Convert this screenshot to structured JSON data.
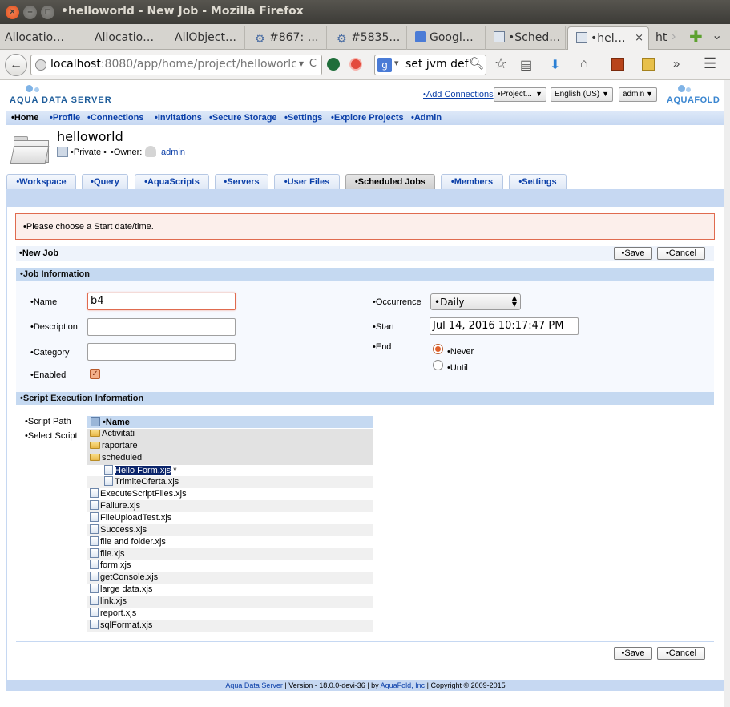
{
  "window": {
    "title": "•helloworld - New Job - Mozilla Firefox",
    "close": "×",
    "minimize": "–",
    "maximize": "□"
  },
  "tabs": [
    {
      "label": "Allocatio…",
      "icon": "ellipsis-icon"
    },
    {
      "label": "Allocatio…"
    },
    {
      "label": "AllObject…"
    },
    {
      "label": "#867: …",
      "icon": "gear-icon"
    },
    {
      "label": "#5835…",
      "icon": "gear-icon"
    },
    {
      "label": "Googl…",
      "icon": "google-translate-icon"
    },
    {
      "label": "•Sched…",
      "icon": "page-icon"
    },
    {
      "label": "•hel…",
      "icon": "page-icon",
      "active": true,
      "close": "×"
    },
    {
      "label": "ht"
    }
  ],
  "tabstrip": {
    "scroll_right": "›",
    "new_tab": "✚",
    "list_tabs": "⌄"
  },
  "nav": {
    "url_host": "localhost",
    "url_rest": ":8080/app/home/project/helloworlc",
    "search_text": "set jvm defa",
    "back": "←",
    "dropdown": "▾",
    "reload": "C",
    "search_engine": "g"
  },
  "app": {
    "logo_left": "AQUA DATA SERVER",
    "logo_right": "AQUAFOLD",
    "add_connections": "•Add Connections",
    "project_select": "•Project...",
    "language_select": "English (US)",
    "user_select": "admin"
  },
  "menu": [
    {
      "label": "•Home",
      "current": true
    },
    {
      "label": "•Profile"
    },
    {
      "label": "•Connections"
    },
    {
      "label": "•Invitations"
    },
    {
      "label": "•Secure Storage"
    },
    {
      "label": "•Settings"
    },
    {
      "label": "•Explore Projects"
    },
    {
      "label": "•Admin"
    }
  ],
  "project": {
    "name": "helloworld",
    "privacy": "•Private •",
    "owner_label": "•Owner:",
    "owner": "admin"
  },
  "project_tabs": [
    {
      "label": "•Workspace"
    },
    {
      "label": "•Query"
    },
    {
      "label": "•AquaScripts"
    },
    {
      "label": "•Servers"
    },
    {
      "label": "•User Files"
    },
    {
      "label": "•Scheduled Jobs",
      "active": true
    },
    {
      "label": "•Members"
    },
    {
      "label": "•Settings"
    }
  ],
  "error_message": "•Please choose a Start date/time.",
  "form": {
    "title": "•New Job",
    "save": "•Save",
    "cancel": "•Cancel",
    "job_info_header": "•Job Information",
    "name_label": "•Name",
    "name_value": "b4",
    "description_label": "•Description",
    "description_value": "",
    "category_label": "•Category",
    "category_value": "",
    "enabled_label": "•Enabled",
    "enabled": true,
    "occurrence_label": "•Occurrence",
    "occurrence_value": "•Daily",
    "start_label": "•Start",
    "start_value": "Jul 14, 2016 10:17:47 PM",
    "end_label": "•End",
    "end_never": "•Never",
    "end_until": "•Until",
    "end_selected": "never",
    "script_header": "•Script Execution Information",
    "script_path_label": "•Script Path",
    "select_script_label": "•Select Script"
  },
  "tree": {
    "header": "•Name",
    "rows": [
      {
        "label": "Activitati",
        "type": "folder",
        "level": 0
      },
      {
        "label": "raportare",
        "type": "folder",
        "level": 0
      },
      {
        "label": "scheduled",
        "type": "folder",
        "level": 0
      },
      {
        "label": "Hello Form.xjs",
        "type": "file",
        "level": 1,
        "selected": true,
        "suffix": "*"
      },
      {
        "label": "TrimiteOferta.xjs",
        "type": "file",
        "level": 1
      },
      {
        "label": "ExecuteScriptFiles.xjs",
        "type": "file",
        "level": 0
      },
      {
        "label": "Failure.xjs",
        "type": "file",
        "level": 0
      },
      {
        "label": "FileUploadTest.xjs",
        "type": "file",
        "level": 0
      },
      {
        "label": "Success.xjs",
        "type": "file",
        "level": 0
      },
      {
        "label": "file and folder.xjs",
        "type": "file",
        "level": 0
      },
      {
        "label": "file.xjs",
        "type": "file",
        "level": 0
      },
      {
        "label": "form.xjs",
        "type": "file",
        "level": 0
      },
      {
        "label": "getConsole.xjs",
        "type": "file",
        "level": 0
      },
      {
        "label": "large data.xjs",
        "type": "file",
        "level": 0
      },
      {
        "label": "link.xjs",
        "type": "file",
        "level": 0
      },
      {
        "label": "report.xjs",
        "type": "file",
        "level": 0
      },
      {
        "label": "sqlFormat.xjs",
        "type": "file",
        "level": 0
      }
    ]
  },
  "footer": {
    "product_link": "Aqua Data Server",
    "version": " | Version - 18.0.0-devi-36 | by ",
    "company_link": "AquaFold, Inc",
    "copyright": " | Copyright © 2009-2015"
  },
  "colors": {
    "accent_link": "#0b3fa8",
    "menu_bg": "#c6d8f2",
    "section_bg": "#c5d9f1",
    "error_bg": "#fcefeb",
    "error_border": "#e06b4f",
    "selected_bg": "#0a246a"
  }
}
